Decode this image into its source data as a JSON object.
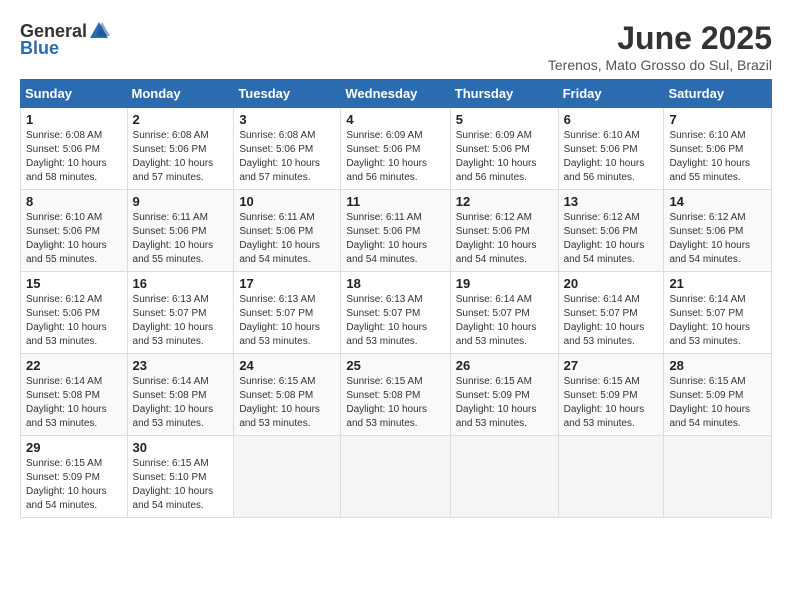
{
  "header": {
    "logo_general": "General",
    "logo_blue": "Blue",
    "month_year": "June 2025",
    "location": "Terenos, Mato Grosso do Sul, Brazil"
  },
  "days_of_week": [
    "Sunday",
    "Monday",
    "Tuesday",
    "Wednesday",
    "Thursday",
    "Friday",
    "Saturday"
  ],
  "weeks": [
    [
      {
        "day": "1",
        "lines": [
          "Sunrise: 6:08 AM",
          "Sunset: 5:06 PM",
          "Daylight: 10 hours",
          "and 58 minutes."
        ]
      },
      {
        "day": "2",
        "lines": [
          "Sunrise: 6:08 AM",
          "Sunset: 5:06 PM",
          "Daylight: 10 hours",
          "and 57 minutes."
        ]
      },
      {
        "day": "3",
        "lines": [
          "Sunrise: 6:08 AM",
          "Sunset: 5:06 PM",
          "Daylight: 10 hours",
          "and 57 minutes."
        ]
      },
      {
        "day": "4",
        "lines": [
          "Sunrise: 6:09 AM",
          "Sunset: 5:06 PM",
          "Daylight: 10 hours",
          "and 56 minutes."
        ]
      },
      {
        "day": "5",
        "lines": [
          "Sunrise: 6:09 AM",
          "Sunset: 5:06 PM",
          "Daylight: 10 hours",
          "and 56 minutes."
        ]
      },
      {
        "day": "6",
        "lines": [
          "Sunrise: 6:10 AM",
          "Sunset: 5:06 PM",
          "Daylight: 10 hours",
          "and 56 minutes."
        ]
      },
      {
        "day": "7",
        "lines": [
          "Sunrise: 6:10 AM",
          "Sunset: 5:06 PM",
          "Daylight: 10 hours",
          "and 55 minutes."
        ]
      }
    ],
    [
      {
        "day": "8",
        "lines": [
          "Sunrise: 6:10 AM",
          "Sunset: 5:06 PM",
          "Daylight: 10 hours",
          "and 55 minutes."
        ]
      },
      {
        "day": "9",
        "lines": [
          "Sunrise: 6:11 AM",
          "Sunset: 5:06 PM",
          "Daylight: 10 hours",
          "and 55 minutes."
        ]
      },
      {
        "day": "10",
        "lines": [
          "Sunrise: 6:11 AM",
          "Sunset: 5:06 PM",
          "Daylight: 10 hours",
          "and 54 minutes."
        ]
      },
      {
        "day": "11",
        "lines": [
          "Sunrise: 6:11 AM",
          "Sunset: 5:06 PM",
          "Daylight: 10 hours",
          "and 54 minutes."
        ]
      },
      {
        "day": "12",
        "lines": [
          "Sunrise: 6:12 AM",
          "Sunset: 5:06 PM",
          "Daylight: 10 hours",
          "and 54 minutes."
        ]
      },
      {
        "day": "13",
        "lines": [
          "Sunrise: 6:12 AM",
          "Sunset: 5:06 PM",
          "Daylight: 10 hours",
          "and 54 minutes."
        ]
      },
      {
        "day": "14",
        "lines": [
          "Sunrise: 6:12 AM",
          "Sunset: 5:06 PM",
          "Daylight: 10 hours",
          "and 54 minutes."
        ]
      }
    ],
    [
      {
        "day": "15",
        "lines": [
          "Sunrise: 6:12 AM",
          "Sunset: 5:06 PM",
          "Daylight: 10 hours",
          "and 53 minutes."
        ]
      },
      {
        "day": "16",
        "lines": [
          "Sunrise: 6:13 AM",
          "Sunset: 5:07 PM",
          "Daylight: 10 hours",
          "and 53 minutes."
        ]
      },
      {
        "day": "17",
        "lines": [
          "Sunrise: 6:13 AM",
          "Sunset: 5:07 PM",
          "Daylight: 10 hours",
          "and 53 minutes."
        ]
      },
      {
        "day": "18",
        "lines": [
          "Sunrise: 6:13 AM",
          "Sunset: 5:07 PM",
          "Daylight: 10 hours",
          "and 53 minutes."
        ]
      },
      {
        "day": "19",
        "lines": [
          "Sunrise: 6:14 AM",
          "Sunset: 5:07 PM",
          "Daylight: 10 hours",
          "and 53 minutes."
        ]
      },
      {
        "day": "20",
        "lines": [
          "Sunrise: 6:14 AM",
          "Sunset: 5:07 PM",
          "Daylight: 10 hours",
          "and 53 minutes."
        ]
      },
      {
        "day": "21",
        "lines": [
          "Sunrise: 6:14 AM",
          "Sunset: 5:07 PM",
          "Daylight: 10 hours",
          "and 53 minutes."
        ]
      }
    ],
    [
      {
        "day": "22",
        "lines": [
          "Sunrise: 6:14 AM",
          "Sunset: 5:08 PM",
          "Daylight: 10 hours",
          "and 53 minutes."
        ]
      },
      {
        "day": "23",
        "lines": [
          "Sunrise: 6:14 AM",
          "Sunset: 5:08 PM",
          "Daylight: 10 hours",
          "and 53 minutes."
        ]
      },
      {
        "day": "24",
        "lines": [
          "Sunrise: 6:15 AM",
          "Sunset: 5:08 PM",
          "Daylight: 10 hours",
          "and 53 minutes."
        ]
      },
      {
        "day": "25",
        "lines": [
          "Sunrise: 6:15 AM",
          "Sunset: 5:08 PM",
          "Daylight: 10 hours",
          "and 53 minutes."
        ]
      },
      {
        "day": "26",
        "lines": [
          "Sunrise: 6:15 AM",
          "Sunset: 5:09 PM",
          "Daylight: 10 hours",
          "and 53 minutes."
        ]
      },
      {
        "day": "27",
        "lines": [
          "Sunrise: 6:15 AM",
          "Sunset: 5:09 PM",
          "Daylight: 10 hours",
          "and 53 minutes."
        ]
      },
      {
        "day": "28",
        "lines": [
          "Sunrise: 6:15 AM",
          "Sunset: 5:09 PM",
          "Daylight: 10 hours",
          "and 54 minutes."
        ]
      }
    ],
    [
      {
        "day": "29",
        "lines": [
          "Sunrise: 6:15 AM",
          "Sunset: 5:09 PM",
          "Daylight: 10 hours",
          "and 54 minutes."
        ]
      },
      {
        "day": "30",
        "lines": [
          "Sunrise: 6:15 AM",
          "Sunset: 5:10 PM",
          "Daylight: 10 hours",
          "and 54 minutes."
        ]
      },
      {
        "day": "",
        "lines": []
      },
      {
        "day": "",
        "lines": []
      },
      {
        "day": "",
        "lines": []
      },
      {
        "day": "",
        "lines": []
      },
      {
        "day": "",
        "lines": []
      }
    ]
  ]
}
